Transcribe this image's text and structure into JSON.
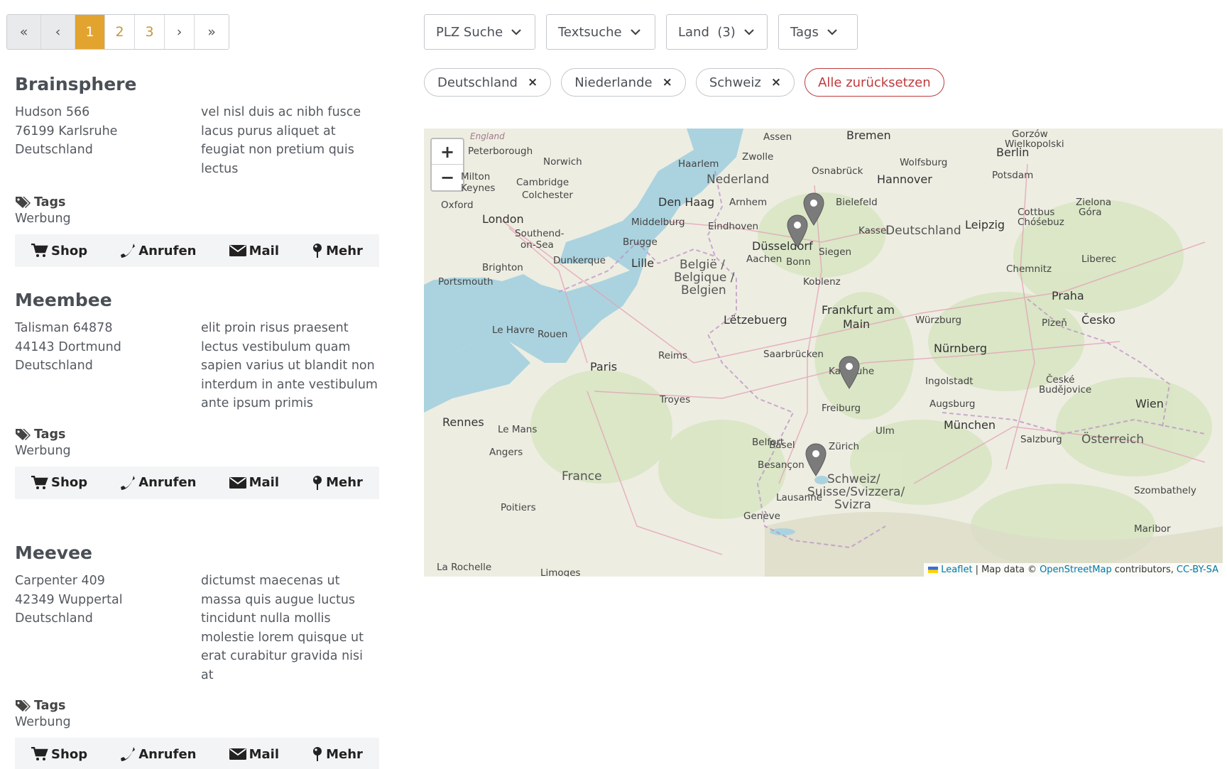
{
  "pagination": {
    "first": "«",
    "prev": "‹",
    "pages": [
      "1",
      "2",
      "3"
    ],
    "active": "1",
    "next": "›",
    "last": "»"
  },
  "filters": {
    "dropdowns": [
      "PLZ Suche",
      "Textsuche",
      "Land  (3)",
      "Tags"
    ],
    "chips": [
      "Deutschland",
      "Niederlande",
      "Schweiz"
    ],
    "reset_label": "Alle zurücksetzen",
    "chip_remove": "×"
  },
  "listings": [
    {
      "name": "Brainsphere",
      "street": "Hudson 566",
      "city": "76199 Karlsruhe",
      "country": "Deutschland",
      "description": "vel nisl duis ac nibh fusce lacus purus aliquet at feugiat non pretium quis lectus",
      "tags_label": "Tags",
      "tags": "Werbung"
    },
    {
      "name": "Meembee",
      "street": "Talisman 64878",
      "city": "44143 Dortmund",
      "country": "Deutschland",
      "description": "elit proin risus praesent lectus vestibulum quam sapien varius ut blandit non interdum in ante vestibulum ante ipsum primis",
      "tags_label": "Tags",
      "tags": "Werbung"
    },
    {
      "name": "Meevee",
      "street": "Carpenter 409",
      "city": "42349 Wuppertal",
      "country": "Deutschland",
      "description": "dictumst maecenas ut massa quis augue luctus tincidunt nulla mollis molestie lorem quisque ut erat curabitur gravida nisi at",
      "tags_label": "Tags",
      "tags": "Werbung"
    }
  ],
  "actions": {
    "shop": "Shop",
    "call": "Anrufen",
    "mail": "Mail",
    "more": "Mehr"
  },
  "map": {
    "zoom_in": "+",
    "zoom_out": "−",
    "attribution": {
      "leaflet": "Leaflet",
      "separator": "| Map data ©",
      "osm": "OpenStreetMap",
      "contributors": "contributors,",
      "license": "CC-BY-SA"
    },
    "labels": {
      "bremen": "Bremen",
      "berlin": "Berlin",
      "hannover": "Hannover",
      "nederland": "Nederland",
      "denhaag": "Den Haag",
      "london": "London",
      "deutschland": "Deutschland",
      "duesseldorf": "Düsseldorf",
      "leipzig": "Leipzig",
      "frankfurt": "Frankfurt am",
      "main": "Main",
      "belgie": "België /",
      "belgique": "Belgique /",
      "belgien": "Belgien",
      "letzebuerg": "Lëtzebuerg",
      "paris": "Paris",
      "nuernberg": "Nürnberg",
      "praha": "Praha",
      "cesko": "Česko",
      "muenchen": "München",
      "wien": "Wien",
      "oesterreich": "Österreich",
      "france": "France",
      "schweiz": "Schweiz/",
      "suisse": "Suisse/Svizzera/",
      "svizra": "Svizra",
      "rennes": "Rennes",
      "lille": "Lille",
      "karlsruhe": "Karlsruhe",
      "zuerich": "Zürich",
      "brighton": "Brighton",
      "oxford": "Oxford",
      "norwich": "Norwich",
      "cambridge": "Cambridge",
      "kassel": "Kassel",
      "bielefeld": "Bielefeld",
      "osnabrueck": "Osnabrück",
      "potsdam": "Potsdam",
      "wolfsburg": "Wolfsburg",
      "chemnitz": "Chemnitz",
      "reims": "Reims",
      "troyes": "Troyes",
      "lemans": "Le Mans",
      "angers": "Angers",
      "rouen": "Rouen",
      "lehavre": "Le Havre",
      "saarbruecken": "Saarbrücken",
      "freiburg": "Freiburg",
      "augsburg": "Augsburg",
      "ulm": "Ulm",
      "salzburg": "Salzburg",
      "geneve": "Genève",
      "lausanne": "Lausanne",
      "besancon": "Besançon",
      "poitiers": "Poitiers",
      "limoges": "Limoges",
      "larochelle": "La Rochelle",
      "wuerzburg": "Würzburg",
      "plzen": "Plzeň",
      "ingolstadt": "Ingolstadt",
      "koblenz": "Koblenz",
      "bonn": "Bonn",
      "aachen": "Aachen",
      "siegen": "Siegen",
      "eindhoven": "Eindhoven",
      "arnhem": "Arnhem",
      "zwolle": "Zwolle",
      "haarlem": "Haarlem",
      "assen": "Assen",
      "brugge": "Brugge",
      "dunkerque": "Dunkerque",
      "middelburg": "Middelburg",
      "peterborough": "Peterborough",
      "portsmouth": "Portsmouth",
      "southend": "Southend-",
      "onsea": "on-Sea",
      "colchester": "Colchester",
      "milton": "Milton",
      "keynes": "Keynes",
      "belfort": "Belfort",
      "basel": "Basel",
      "liberec": "Liberec",
      "cottbus": "Cottbus",
      "chosebuz": "Chóśebuz",
      "zielona": "Zielona",
      "gora": "Góra",
      "ceske": "České",
      "budejovice": "Budějovice",
      "szombathely": "Szombathely",
      "maribor": "Maribor",
      "gorzow": "Gorzów",
      "wielkopolski": "Wielkopolski",
      "england": "England"
    },
    "pins": [
      "Dortmund",
      "Wuppertal",
      "Karlsruhe",
      "Basel"
    ],
    "colors": {
      "sea": "#aad3df",
      "land": "#eeede2",
      "forest": "#cfe0b4",
      "pin": "#7b7b7b"
    }
  }
}
